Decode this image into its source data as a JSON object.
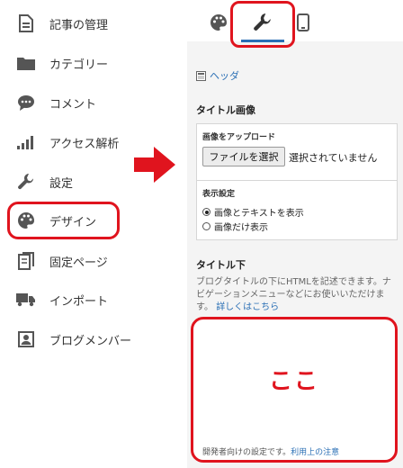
{
  "sidebar": {
    "items": [
      {
        "label": "記事の管理",
        "icon": "document-icon"
      },
      {
        "label": "カテゴリー",
        "icon": "folder-icon"
      },
      {
        "label": "コメント",
        "icon": "comment-icon"
      },
      {
        "label": "アクセス解析",
        "icon": "bar-chart-icon"
      },
      {
        "label": "設定",
        "icon": "wrench-icon"
      },
      {
        "label": "デザイン",
        "icon": "palette-icon"
      },
      {
        "label": "固定ページ",
        "icon": "pages-icon"
      },
      {
        "label": "インポート",
        "icon": "truck-icon"
      },
      {
        "label": "ブログメンバー",
        "icon": "member-icon"
      }
    ]
  },
  "tabs": [
    {
      "name": "palette-icon"
    },
    {
      "name": "wrench-icon",
      "active": true
    },
    {
      "name": "smartphone-icon"
    }
  ],
  "panel": {
    "section_link": "ヘッダ",
    "title_image_heading": "タイトル画像",
    "upload_label": "画像をアップロード",
    "file_button": "ファイルを選択",
    "file_status": "選択されていません",
    "display_label": "表示設定",
    "options": [
      {
        "label": "画像とテキストを表示",
        "checked": true
      },
      {
        "label": "画像だけ表示",
        "checked": false
      }
    ],
    "below_title_heading": "タイトル下",
    "description": "ブログタイトルの下にHTMLを記述できます。ナビゲーションメニューなどにお使いいただけます。",
    "details_link": "詳しくはこちら",
    "annotation": "ここ",
    "footer_text": "開発者向けの設定です。",
    "footer_link": "利用上の注意"
  },
  "colors": {
    "highlight": "#e0141e",
    "link": "#2a6fb5",
    "icon": "#555555"
  }
}
